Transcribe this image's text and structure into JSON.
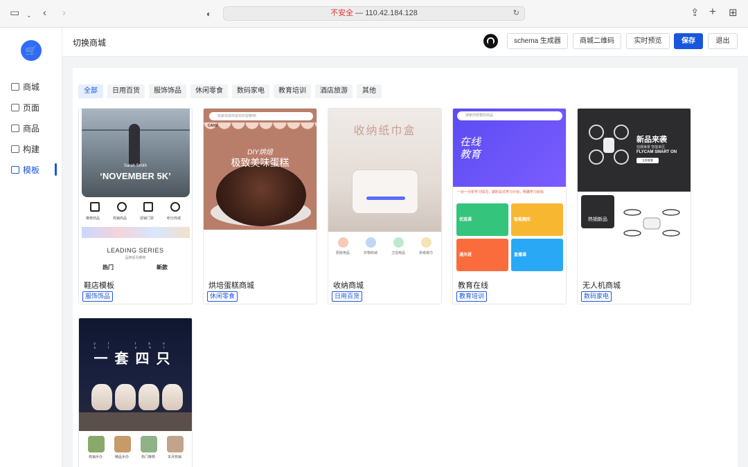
{
  "browser": {
    "url_insecure": "不安全",
    "url_text": " — 110.42.184.128"
  },
  "sidebar": {
    "items": [
      {
        "label": "商城",
        "icon": "store-icon"
      },
      {
        "label": "页面",
        "icon": "page-icon"
      },
      {
        "label": "商品",
        "icon": "goods-icon"
      },
      {
        "label": "构建",
        "icon": "build-icon"
      },
      {
        "label": "模板",
        "icon": "template-icon",
        "active": true
      }
    ]
  },
  "header": {
    "switch_mall": "切换商城",
    "buttons": {
      "schema": "schema 生成器",
      "qrcode": "商城二维码",
      "preview": "实时预览",
      "save": "保存",
      "logout": "退出"
    }
  },
  "tabs": [
    "全部",
    "日用百货",
    "服饰饰品",
    "休闲零食",
    "数码家电",
    "教育培训",
    "酒店旅游",
    "其他"
  ],
  "cards": [
    {
      "name": "鞋店模板",
      "tag": "服饰饰品",
      "thumb": {
        "person": "Sarah Smith",
        "headline": "‘NOVEMBER 5K’",
        "mini_labels": [
          "推荐商品",
          "热销商品",
          "促销门票",
          "积分商城"
        ],
        "series": "LEADING SERIES",
        "series_sub": "品牌系列推荐",
        "tab_left": "热门",
        "tab_right": "新款"
      }
    },
    {
      "name": "烘培蛋糕商城",
      "tag": "休闲零食",
      "thumb": {
        "search": "快来找找你喜欢的蛋糕吧!",
        "brand": "CAKE",
        "diy": "DIY烘焙",
        "title": "极致美味蛋糕"
      }
    },
    {
      "name": "收纳商城",
      "tag": "日用百货",
      "thumb": {
        "title": "收纳纸巾盒",
        "labels": [
          "厨房用品",
          "衣物收纳",
          "卫浴用品",
          "折纸纸巾"
        ]
      }
    },
    {
      "name": "教育在线",
      "tag": "教育培训",
      "thumb": {
        "search": "搜索你想要的商品",
        "title_line1": "在线",
        "title_line2": "教育",
        "notice": "一对一分析学习情况，做阶段式学习计划，明确学习目标",
        "tiles": [
          "优选课",
          "智能题库",
          "通关班",
          "直播课"
        ]
      }
    },
    {
      "name": "无人机商城",
      "tag": "数码家电",
      "thumb": {
        "title": "新品来袭",
        "sub": "拍摄美景 智能来区",
        "model": "FLYCAM SMART ON",
        "button": "立即查看",
        "badge": "热销新品"
      }
    },
    {
      "name": "",
      "tag": "",
      "thumb": {
        "title": "一套四只",
        "pinyin": "yī tào sì zhī",
        "labels": [
          "热销手办",
          "精品手办",
          "热门推荐",
          "本月热销"
        ]
      }
    }
  ],
  "colors": {
    "accent": "#1a56db",
    "tab_active_bg": "#e6efff",
    "logo": "#2f6bff"
  }
}
